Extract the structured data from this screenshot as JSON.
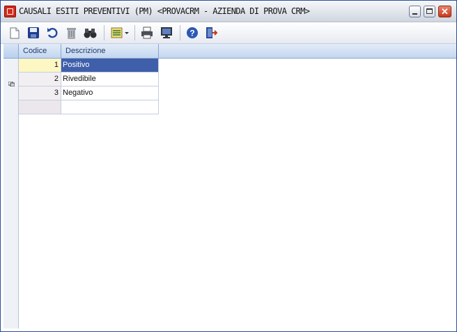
{
  "window": {
    "title": "CAUSALI ESITI PREVENTIVI (PM) <PROVACRM - AZIENDA DI PROVA CRM>",
    "accent": "#d42a1a"
  },
  "titlebar_buttons": {
    "minimize": "minimize-icon",
    "maximize": "maximize-icon",
    "close": "close-icon"
  },
  "toolbar": {
    "buttons": [
      "new-document-icon",
      "save-icon",
      "undo-icon",
      "delete-icon",
      "search-binoculars-icon",
      "view-options-icon",
      "print-icon",
      "preview-monitor-icon",
      "help-icon",
      "exit-icon"
    ]
  },
  "grid": {
    "columns": [
      "Codice",
      "Descrizione"
    ],
    "rows": [
      {
        "code": "1",
        "description": "Positivo",
        "selected": true
      },
      {
        "code": "2",
        "description": "Rivedibile",
        "selected": false
      },
      {
        "code": "3",
        "description": "Negativo",
        "selected": false
      },
      {
        "code": "",
        "description": "",
        "selected": false
      }
    ],
    "selection_color": "#3f5faa"
  }
}
